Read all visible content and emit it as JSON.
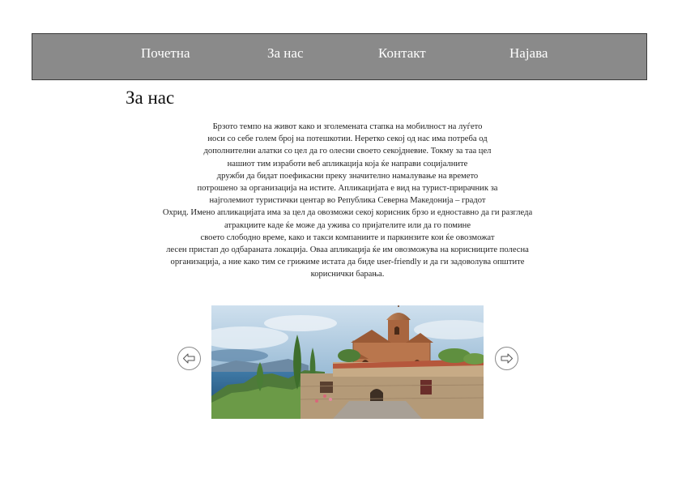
{
  "nav": {
    "items": [
      {
        "label": "Почетна"
      },
      {
        "label": "За нас"
      },
      {
        "label": "Контакт"
      },
      {
        "label": "Најава"
      }
    ]
  },
  "main": {
    "title": "За нас",
    "paragraph_lines": [
      "Брзото темпо на живот како и зголемената стапка на мобилност на луѓето",
      "носи со себе голем број на потешкотии. Неретко секој од нас има потреба од",
      "дополнителни алатки со цел да го олесни своето секојдневие. Токму за таа цел",
      "нашиот тим изработи веб апликација која ќе направи социјалните",
      "дружби да бидат поефикасни преку значително намалување на времето",
      "потрошено за организација на истите. Апликацијата е вид на турист-прирачник за",
      "најголемиот туристички центар во Република Северна Македонија – градот",
      "Охрид. Имено апликацијата има за цел да овозможи секој корисник брзо и едноставно да ги разгледа",
      "атракциите каде ќе може да ужива со пријателите или да го помине",
      "своето слободно време, како и такси компаниите и паркинзите кои ќе овозможат",
      "лесен пристап до одбараната локација. Оваа апликација ќе им овозможува на корисниците полесна",
      "организација, а ние како тим се грижиме истата да биде user-friendly и да ги задоволува општите",
      "кориснички барања."
    ]
  },
  "gallery": {
    "prev_icon": "arrow-left-icon",
    "next_icon": "arrow-right-icon",
    "image_subject": "church-on-lake-cliff-photo"
  },
  "colors": {
    "navbar_bg": "#8a8a8a",
    "navbar_border": "#3a3a3a",
    "nav_text": "#ffffff",
    "body_text": "#222222"
  }
}
